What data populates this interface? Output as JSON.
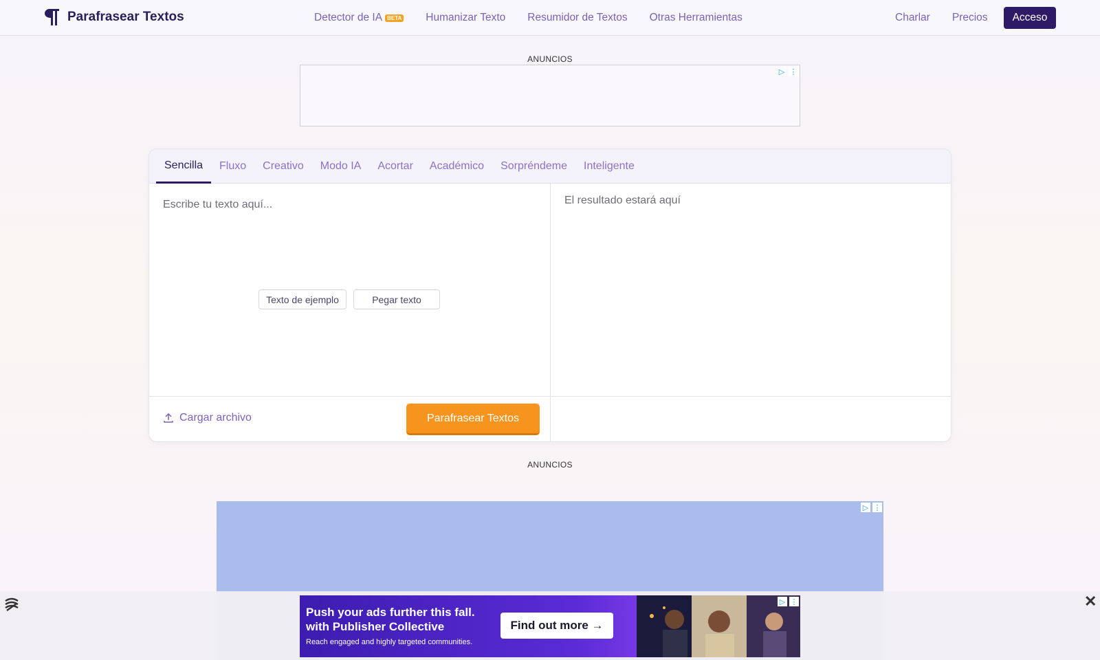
{
  "header": {
    "brand": "Parafrasear Textos",
    "nav": [
      {
        "label": "Detector de IA",
        "badge": "BETA"
      },
      {
        "label": "Humanizar Texto"
      },
      {
        "label": "Resumidor de Textos"
      },
      {
        "label": "Otras Herramientas"
      }
    ],
    "right_links": [
      "Charlar",
      "Precios"
    ],
    "login": "Acceso"
  },
  "ads": {
    "label_top": "ANUNCIOS",
    "label_bottom": "ANUNCIOS"
  },
  "tool": {
    "tabs": [
      "Sencilla",
      "Fluxo",
      "Creativo",
      "Modo IA",
      "Acortar",
      "Académico",
      "Sorpréndeme",
      "Inteligente"
    ],
    "active_tab": "Sencilla",
    "input_placeholder": "Escribe tu texto aquí...",
    "output_placeholder": "El resultado estará aquí",
    "sample_button": "Texto de ejemplo",
    "paste_button": "Pegar texto",
    "upload": "Cargar archivo",
    "submit": "Parafrasear Textos"
  },
  "banner": {
    "headline_1": "Push your ads further this fall.",
    "headline_2": "with Publisher Collective",
    "sub": "Reach engaged and highly targeted communities.",
    "cta": "Find out more →"
  },
  "colors": {
    "brand_dark": "#2e1a66",
    "link": "#7a62b8",
    "accent_orange": "#f7941d",
    "beta": "#f6a21e"
  }
}
